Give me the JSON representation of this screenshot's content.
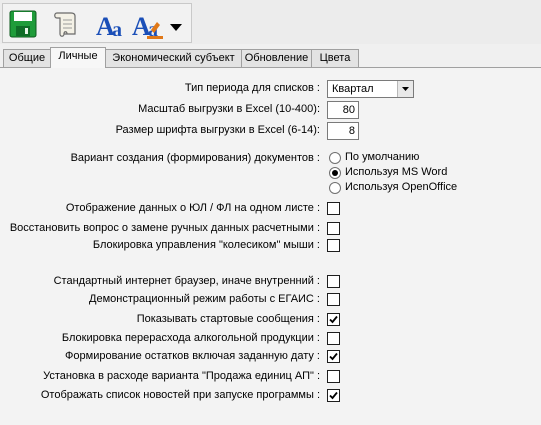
{
  "toolbar": {
    "buttons": [
      {
        "icon": "save-icon"
      },
      {
        "icon": "scroll-icon"
      },
      {
        "icon": "font-style-icon"
      },
      {
        "icon": "font-color-icon"
      },
      {
        "icon": "dropdown-arrow-icon"
      }
    ]
  },
  "tabs": [
    {
      "label": "Общие",
      "active": false
    },
    {
      "label": "Личные",
      "active": true
    },
    {
      "label": "Экономический субъект",
      "active": false
    },
    {
      "label": "Обновление",
      "active": false
    },
    {
      "label": "Цвета",
      "active": false
    }
  ],
  "form": {
    "period_type": {
      "label": "Тип периода для списков :",
      "value": "Квартал"
    },
    "excel_scale": {
      "label": "Масштаб выгрузки в Excel (10-400):",
      "value": "80"
    },
    "excel_font": {
      "label": "Размер шрифта выгрузки в Excel (6-14):",
      "value": "8"
    },
    "doc_variant": {
      "label": "Вариант создания (формирования) документов :",
      "options": [
        {
          "label": "По умолчанию",
          "selected": false
        },
        {
          "label": "Используя MS Word",
          "selected": true
        },
        {
          "label": "Используя OpenOffice",
          "selected": false
        }
      ]
    },
    "checkboxes": [
      {
        "label": "Отображение данных о ЮЛ / ФЛ на одном листе :",
        "checked": false
      },
      {
        "label": "Восстановить вопрос о замене ручных данных расчетными :",
        "checked": false
      },
      {
        "label": "Блокировка управления \"колесиком\" мыши :",
        "checked": false
      },
      {
        "label": "Стандартный интернет браузер, иначе внутренний :",
        "checked": false
      },
      {
        "label": "Демонстрационный режим работы с ЕГАИС :",
        "checked": false
      },
      {
        "label": "Показывать стартовые сообщения :",
        "checked": true
      },
      {
        "label": "Блокировка перерасхода алкогольной продукции :",
        "checked": false
      },
      {
        "label": "Формирование остатков включая заданную дату :",
        "checked": true
      },
      {
        "label": "Установка в расходе варианта \"Продажа единиц АП\" :",
        "checked": false
      },
      {
        "label": "Отображать список новостей при запуске программы :",
        "checked": true
      }
    ]
  },
  "colors": {
    "save_green": "#1f9c3a",
    "font_blue": "#1b4fb8",
    "font_orange": "#e07818"
  }
}
